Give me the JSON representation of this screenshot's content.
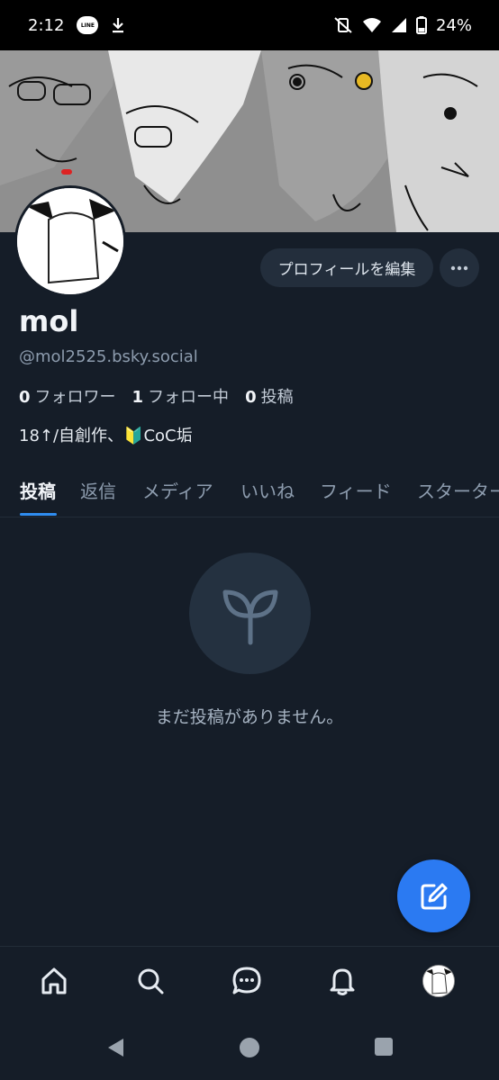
{
  "status_bar": {
    "time": "2:12",
    "line_badge": "LINE",
    "battery": "24%",
    "icons": [
      "line-app-icon",
      "download-icon",
      "vibrate-off-icon",
      "wifi-icon",
      "signal-icon",
      "battery-icon"
    ]
  },
  "profile": {
    "edit_label": "プロフィールを編集",
    "display_name": "mol",
    "handle": "@mol2525.bsky.social",
    "followers_count": "0",
    "followers_label": "フォロワー",
    "following_count": "1",
    "following_label": "フォロー中",
    "posts_count": "0",
    "posts_label": "投稿",
    "bio": "18↑/自創作、🔰CoC垢"
  },
  "tabs": [
    {
      "label": "投稿",
      "active": true
    },
    {
      "label": "返信",
      "active": false
    },
    {
      "label": "メディア",
      "active": false
    },
    {
      "label": "いいね",
      "active": false
    },
    {
      "label": "フィード",
      "active": false
    },
    {
      "label": "スターターパック",
      "active": false
    }
  ],
  "empty_state": {
    "icon": "sprout-icon",
    "text": "まだ投稿がありません。"
  },
  "bottom_nav": [
    "home-icon",
    "search-icon",
    "chat-icon",
    "bell-icon",
    "profile-avatar"
  ],
  "colors": {
    "background": "#151d28",
    "accent": "#2b7af2",
    "tab_underline": "#2f8df0",
    "muted_text": "#8d9cae"
  }
}
